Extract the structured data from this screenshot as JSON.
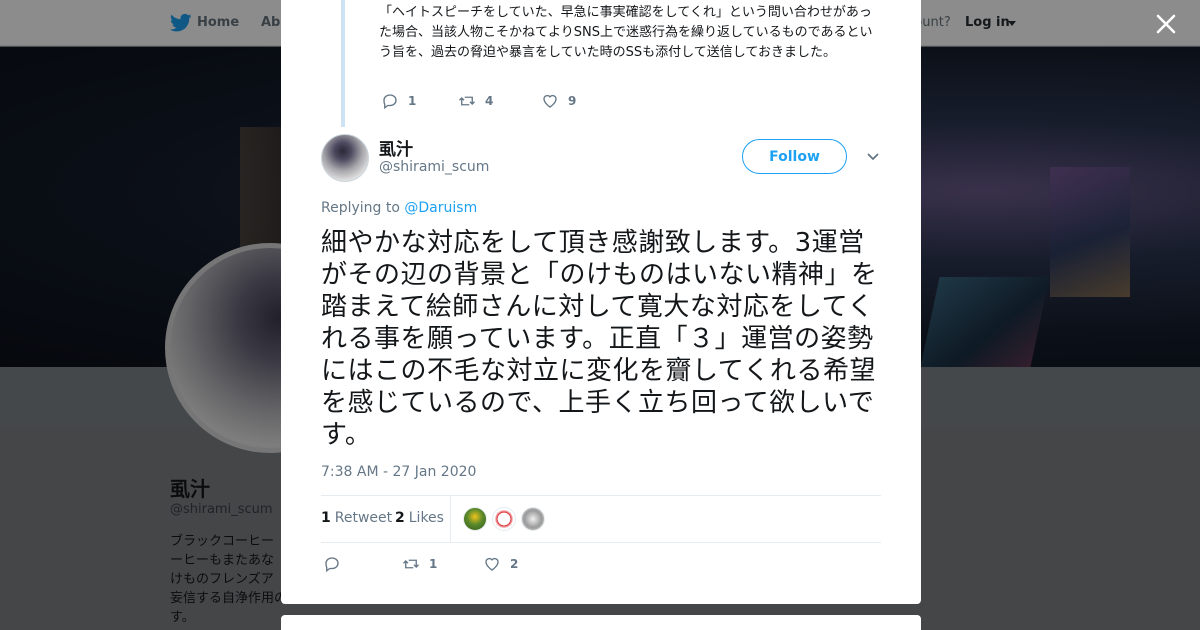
{
  "topbar": {
    "home_label": "Home",
    "about_label": "Abo",
    "have_account_label": "ccount?",
    "login_label": "Log in"
  },
  "profile": {
    "name": "虱汁",
    "handle": "@shirami_scum",
    "bio_lines": [
      "ブラックコーヒー",
      "ーヒーもまたあな",
      "けものフレンズア",
      "妄信する自浄作用のない人達のアンチで",
      "す。"
    ]
  },
  "modal": {
    "parent_tweet": {
      "text": "「ヘイトスピーチをしていた、早急に事実確認をしてくれ」という問い合わせがあった場合、当該人物こそかねてよりSNS上で迷惑行為を繰り返しているものであるという旨を、過去の脅迫や暴言をしていた時のSSも添付して送信しておきました。",
      "reply_count": "1",
      "retweet_count": "4",
      "like_count": "9"
    },
    "tweet": {
      "author_name": "虱汁",
      "author_handle": "@shirami_scum",
      "follow_label": "Follow",
      "replying_prefix": "Replying to",
      "replying_to": "@Daruism",
      "text": "細やかな対応をして頂き感謝致します。3運営がその辺の背景と「のけものはいない精神」を踏まえて絵師さんに対して寛大な対応をしてくれる事を願っています。正直「３」運営の姿勢にはこの不毛な対立に変化を齎してくれる希望を感じているので、上手く立ち回って欲しいです。",
      "timestamp": "7:38 AM - 27 Jan 2020",
      "retweets_count": "1",
      "retweets_label": "Retweet",
      "likes_count": "2",
      "likes_label": "Likes",
      "reply_count": "",
      "retweet_action_count": "1",
      "like_action_count": "2"
    }
  },
  "colors": {
    "accent": "#1da1f2",
    "muted": "#657786",
    "text": "#14171a"
  },
  "icons": [
    "bird-icon",
    "close-icon",
    "chevron-down-icon",
    "reply-icon",
    "retweet-icon",
    "heart-icon"
  ]
}
